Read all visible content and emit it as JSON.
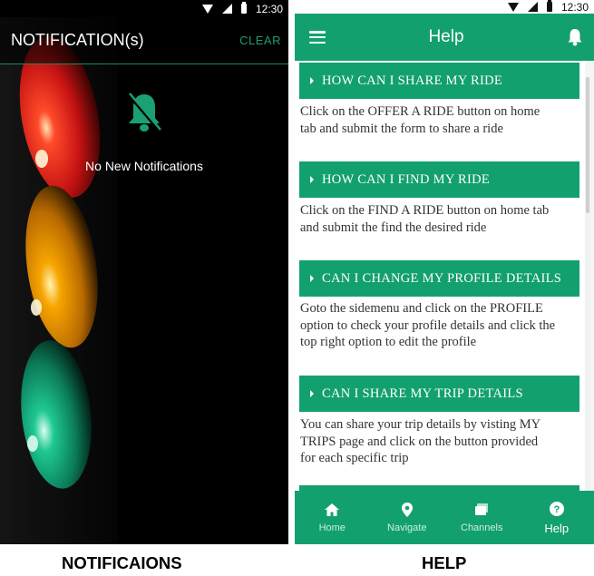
{
  "status_bar": {
    "time": "12:30"
  },
  "notifications_screen": {
    "title": "NOTIFICATION(s)",
    "clear_label": "CLEAR",
    "empty_message": "No New Notifications"
  },
  "help_screen": {
    "title": "Help",
    "faqs": [
      {
        "question": "HOW CAN I SHARE MY RIDE",
        "answer_lines": [
          "Click on the OFFER A RIDE button on home",
          "tab and submit the form to share a ride"
        ]
      },
      {
        "question": "HOW CAN I FIND MY RIDE",
        "answer_lines": [
          "Click on the FIND A RIDE button on home tab",
          "and submit the find the desired ride"
        ]
      },
      {
        "question": "CAN I CHANGE MY PROFILE DETAILS",
        "answer_lines": [
          "Goto the sidemenu and click on the PROFILE",
          "option to check your profile details and click the",
          "top right option to edit the profile"
        ]
      },
      {
        "question": "CAN I SHARE MY TRIP DETAILS",
        "answer_lines": [
          "You can share your trip details by visting MY",
          "TRIPS page and click on the button provided",
          "for each specific trip"
        ]
      }
    ],
    "bottom_nav": [
      {
        "label": "Home",
        "icon": "home-icon"
      },
      {
        "label": "Navigate",
        "icon": "location-pin-icon"
      },
      {
        "label": "Channels",
        "icon": "channels-icon"
      },
      {
        "label": "Help",
        "icon": "help-icon",
        "active": true
      }
    ]
  },
  "captions": {
    "left": "NOTIFICAIONS",
    "right": "HELP"
  },
  "colors": {
    "accent": "#13a06f",
    "clear_text": "#1e9e6e",
    "background_dark": "#000000"
  }
}
